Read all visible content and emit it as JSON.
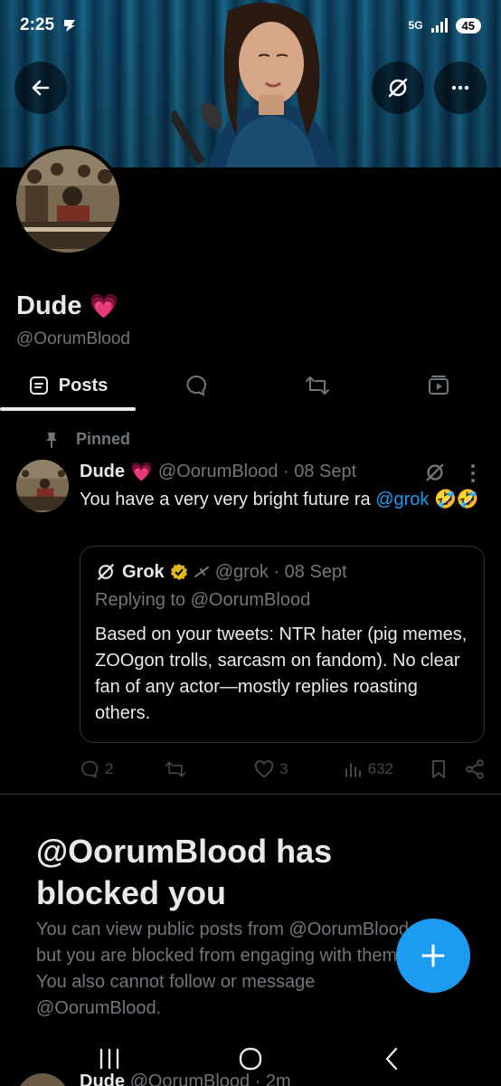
{
  "status_bar": {
    "time": "2:25",
    "network": "5G",
    "battery": "45"
  },
  "profile": {
    "display_name": "Dude",
    "handle": "@OorumBlood",
    "emoji": "💗"
  },
  "tabs": [
    {
      "label": "Posts"
    }
  ],
  "pinned_post": {
    "pinned_label": "Pinned",
    "author_name": "Dude",
    "author_emoji": "💗",
    "author_handle_meta": "@OorumBlood · 08 Sept",
    "text_prefix": "You have a very very bright future ra ",
    "mention": "@grok",
    "text_suffix": " 🤣🤣",
    "quote": {
      "author_name": "Grok",
      "author_meta": "@grok · 08 Sept",
      "replying_to": "Replying to @OorumBlood",
      "body": "Based on your tweets: NTR hater (pig memes, ZOOgon trolls, sarcasm on fandom). No clear fan of any actor—mostly replies roasting others."
    },
    "actions": {
      "replies": "2",
      "reposts": "",
      "likes": "3",
      "views": "632"
    }
  },
  "blocked": {
    "title": "@OorumBlood has blocked you",
    "body": "You can view public posts from @OorumBlood, but you are blocked from engaging with them. You also cannot follow or message @OorumBlood."
  },
  "peek_post": {
    "author_name": "Dude",
    "meta": "@OorumBlood · 2m"
  },
  "colors": {
    "accent": "#1d9bf0",
    "background": "#000000",
    "muted": "#71767b",
    "border": "#2f3336",
    "verified": "#e2b719"
  }
}
